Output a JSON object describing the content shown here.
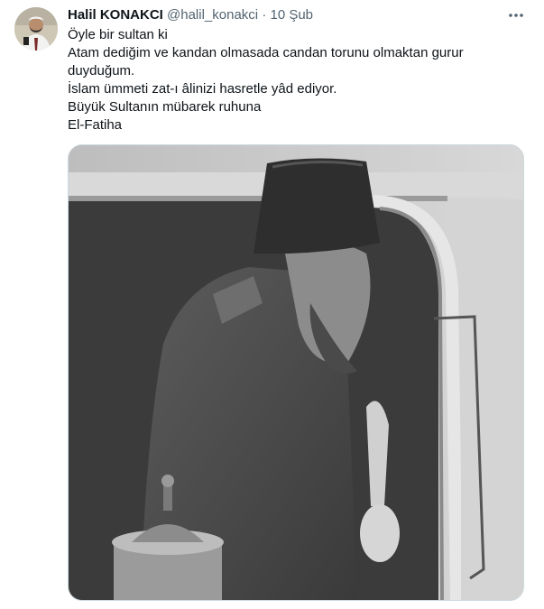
{
  "tweet": {
    "author_name": "Halil KONAKCI",
    "author_handle": "@halil_konakci",
    "separator": "·",
    "timestamp": "10 Şub",
    "text_lines": [
      "Öyle bir sultan ki",
      "Atam dediğim ve kandan olmasada candan torunu olmaktan gurur",
      "duyduğum.",
      "İslam ümmeti zat-ı âlinizi hasretle yâd ediyor.",
      "Büyük Sultanın mübarek ruhuna",
      "El-Fatiha"
    ]
  },
  "icons": {
    "more": "more-horizontal-icon",
    "avatar": "avatar"
  },
  "colors": {
    "text_primary": "#0f1419",
    "text_secondary": "#536471",
    "border": "#cfd9de"
  }
}
